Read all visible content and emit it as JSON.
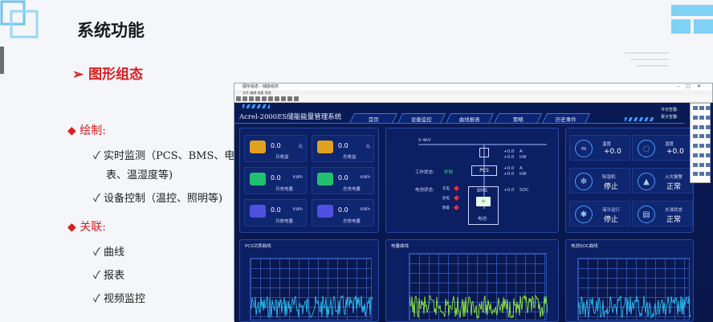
{
  "title": "系统功能",
  "subtitle": "➢ 图形组态",
  "sections": [
    {
      "label": "◆ 绘制:",
      "items": [
        "✓ 实时监测（PCS、BMS、电",
        "表、温湿度等)",
        "✓ 设备控制（温控、照明等)"
      ]
    },
    {
      "label": "◆ 关联:",
      "items": [
        "✓ 曲线",
        "✓ 报表",
        "✓ 视频监控"
      ]
    }
  ],
  "window": {
    "title": "图形组态 - 储能组态",
    "menu": "文件  编辑  查看  帮助",
    "app_title": "Acrel-2000ES储能能量管理系统",
    "tabs": [
      "首页",
      "设备监控",
      "曲线报表",
      "策略",
      "历史事件"
    ],
    "alarms": [
      "今日告警:",
      "累计告警:"
    ],
    "energy_cards": [
      {
        "value": "0.0",
        "unit": "元",
        "label": "日收益",
        "color": "#e0a020"
      },
      {
        "value": "0.0",
        "unit": "元",
        "label": "总收益",
        "color": "#e0a020"
      },
      {
        "value": "0.0",
        "unit": "kWh",
        "label": "日充电量",
        "color": "#20c070"
      },
      {
        "value": "0.0",
        "unit": "kWh",
        "label": "总充电量",
        "color": "#20c070"
      },
      {
        "value": "0.0",
        "unit": "kWh",
        "label": "日放电量",
        "color": "#5050e0"
      },
      {
        "value": "0.0",
        "unit": "kWh",
        "label": "总放电量",
        "color": "#5050e0"
      }
    ],
    "diagram": {
      "voltage": "0.4kV",
      "meter": {
        "v1": "+0.0",
        "u1": "A",
        "v2": "+0.0",
        "u2": "kW"
      },
      "pcs_label": "PCS",
      "pcs": {
        "v1": "+0.0",
        "u1": "A",
        "v2": "+0.0",
        "u2": "kW"
      },
      "work_status_label": "工作状态:",
      "work_status": "并网",
      "battery_status_label": "电池状态:",
      "battery_states": [
        "充电",
        "放电",
        "静置"
      ],
      "bms_label": "BMS",
      "bms": {
        "v1": "+0.0",
        "u1": "SOC"
      },
      "battery_label": "电池"
    },
    "status_cards": [
      {
        "label": "温度",
        "value": "+0.0"
      },
      {
        "label": "湿度",
        "value": "+0.0"
      },
      {
        "label": "除湿机",
        "value": "停止"
      },
      {
        "label": "火灾报警",
        "value": "正常"
      },
      {
        "label": "液冷运行",
        "value": "停止"
      },
      {
        "label": "水浸状态",
        "value": "正常"
      }
    ],
    "charts": [
      {
        "title": "PCS功率曲线",
        "color": "#2fd0ff"
      },
      {
        "title": "电量曲线",
        "color": "#9aff3a"
      },
      {
        "title": "电池SOC曲线",
        "color": "#2fd0ff"
      }
    ]
  }
}
